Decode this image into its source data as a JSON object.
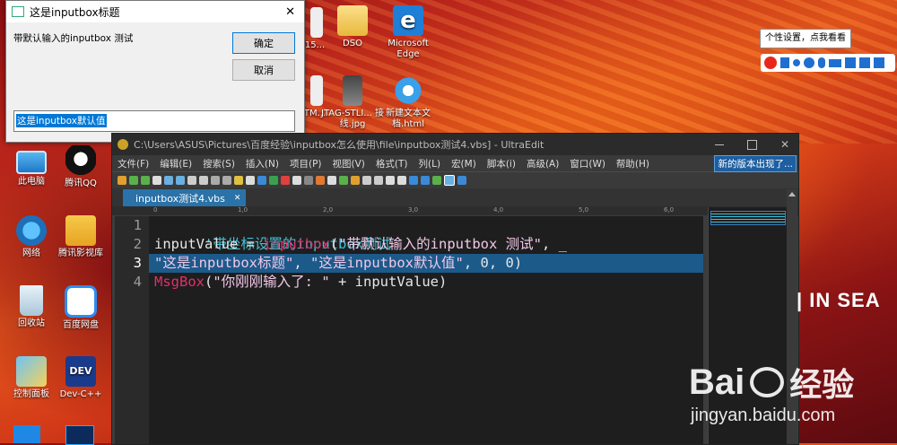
{
  "dialog": {
    "title": "这是inputbox标题",
    "close_glyph": "✕",
    "prompt": "带默认输入的inputbox 测试",
    "ok_label": "确定",
    "cancel_label": "取消",
    "input_value": "这是inputbox默认值"
  },
  "desktop_icons": [
    {
      "label": "此电脑",
      "icon": "computer-icon"
    },
    {
      "label": "腾讯QQ",
      "icon": "qq-icon"
    },
    {
      "label": "网络",
      "icon": "network-icon"
    },
    {
      "label": "腾讯影视库",
      "icon": "video-icon"
    },
    {
      "label": "回收站",
      "icon": "recycle-bin-icon"
    },
    {
      "label": "百度网盘",
      "icon": "baidu-netdisk-icon"
    },
    {
      "label": "控制面板",
      "icon": "control-panel-icon"
    },
    {
      "label": "Dev-C++",
      "icon": "devcpp-icon"
    },
    {
      "label": "DSO",
      "icon": "folder-icon"
    },
    {
      "label": "Microsoft Edge",
      "icon": "edge-icon"
    },
    {
      "label": "JTAG-STLI... 接线.jpg",
      "icon": "image-file-icon"
    },
    {
      "label": "新建文本文 档.html",
      "icon": "ie-icon"
    },
    {
      "label": "15...",
      "icon": "file-icon"
    },
    {
      "label": "TM...",
      "icon": "file-icon"
    }
  ],
  "tooltip": "个性设置，点我看看",
  "ultraedit": {
    "title": "C:\\Users\\ASUS\\Pictures\\百度经验\\inputbox怎么使用\\file\\inputbox测试4.vbs] - UltraEdit",
    "menus": [
      "文件(F)",
      "编辑(E)",
      "搜索(S)",
      "插入(N)",
      "项目(P)",
      "视图(V)",
      "格式(T)",
      "列(L)",
      "宏(M)",
      "脚本(i)",
      "高级(A)",
      "窗口(W)",
      "帮助(H)"
    ],
    "update_notice": "新的版本出现了...",
    "tab_name": "inputbox测试4.vbs",
    "ruler_marks": [
      "0",
      "1,0",
      "2,0",
      "3,0",
      "4,0",
      "5,0",
      "6,0"
    ],
    "line_numbers": [
      "1",
      "2",
      "3",
      "4"
    ],
    "code": {
      "l1": "'带坐标设置的inputbox测试",
      "l2_a": "inputValue = ",
      "l2_b": "inputbox",
      "l2_c": "(",
      "l2_d": "\"带默认输入的inputbox 测试\"",
      "l2_e": ", _",
      "l3_a": "\"这是inputbox标题\"",
      "l3_b": ", ",
      "l3_c": "\"这是inputbox默认值\"",
      "l3_d": ", 0, 0)",
      "l4_a": "MsgBox",
      "l4_b": "(",
      "l4_c": "\"你刚刚输入了: \"",
      "l4_d": " + inputValue)"
    }
  },
  "watermark": {
    "brand": "Bai",
    "brand2": "经验",
    "url": "jingyan.baidu.com",
    "side_text": "| IN SEA"
  },
  "colors": {
    "accent": "#2a72a8",
    "selection": "#1c5a8a",
    "keyword": "#e0306a",
    "comment": "#3fc1d8"
  }
}
